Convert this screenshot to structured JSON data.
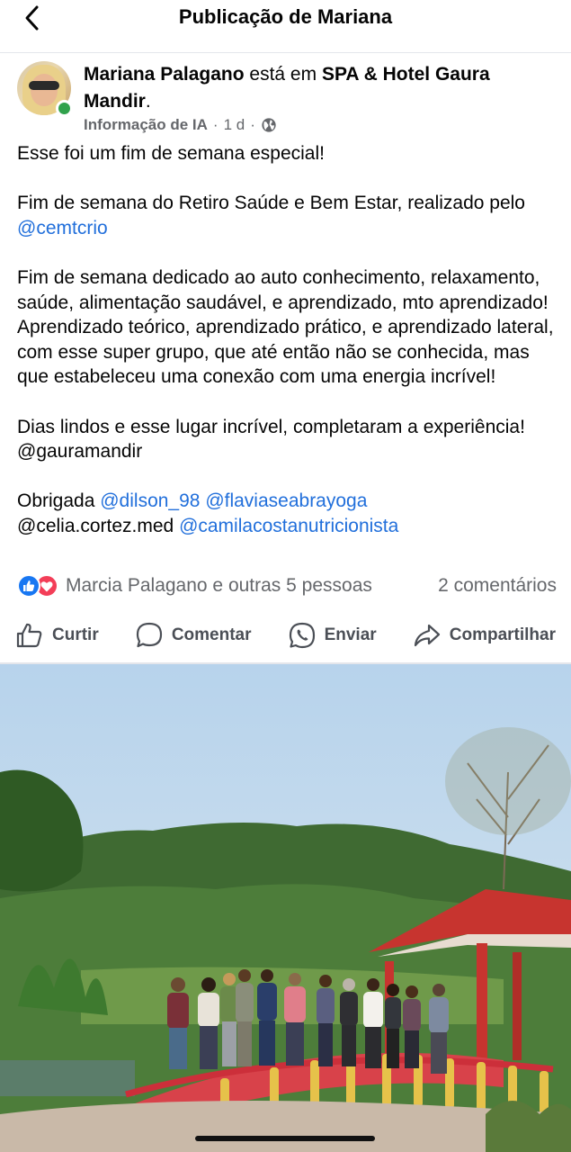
{
  "header": {
    "title": "Publicação de Mariana",
    "back_icon": "chevron-left-icon"
  },
  "post": {
    "author": "Mariana Palagano",
    "is_at": "está em",
    "place": "SPA & Hotel Gaura Mandir",
    "place_suffix": ".",
    "meta": {
      "source": "Informação de IA",
      "sep1": "·",
      "time": "1 d",
      "sep2": "·",
      "privacy_icon": "globe-icon"
    },
    "text": {
      "p1": "Esse foi um fim de semana especial!",
      "p2_text": "Fim de semana do Retiro Saúde e Bem Estar, realizado pelo ",
      "p2_mention": "@cemtcrio",
      "p3": "Fim de semana dedicado ao auto conhecimento, relaxamento, saúde, alimentação saudável, e aprendizado, mto aprendizado! Aprendizado teórico, aprendizado prático, e aprendizado lateral, com esse super grupo, que até então não se conhecida, mas que estabeleceu uma conexão com uma energia incrível!",
      "p4": "Dias lindos e esse lugar incrível, completaram a experiência! @gauramandir",
      "p5_thanks": "Obrigada ",
      "p5_mention1": "@dilson_98",
      "p5_mention2": "@flaviaseabrayoga",
      "p5_plain": "@celia.cortez.med ",
      "p5_mention3": "@camilacostanutricionista"
    },
    "reactions": {
      "summary": "Marcia Palagano e outras 5 pessoas",
      "comments": "2 comentários",
      "icons": [
        "like-icon",
        "love-icon"
      ],
      "like_color": "#1877f2",
      "love_color": "#f33e58"
    },
    "actions": {
      "like": "Curtir",
      "comment": "Comentar",
      "send": "Enviar",
      "share": "Compartilhar"
    }
  },
  "colors": {
    "mention": "#216fdb",
    "meta": "#65676b",
    "online": "#31a24c"
  }
}
